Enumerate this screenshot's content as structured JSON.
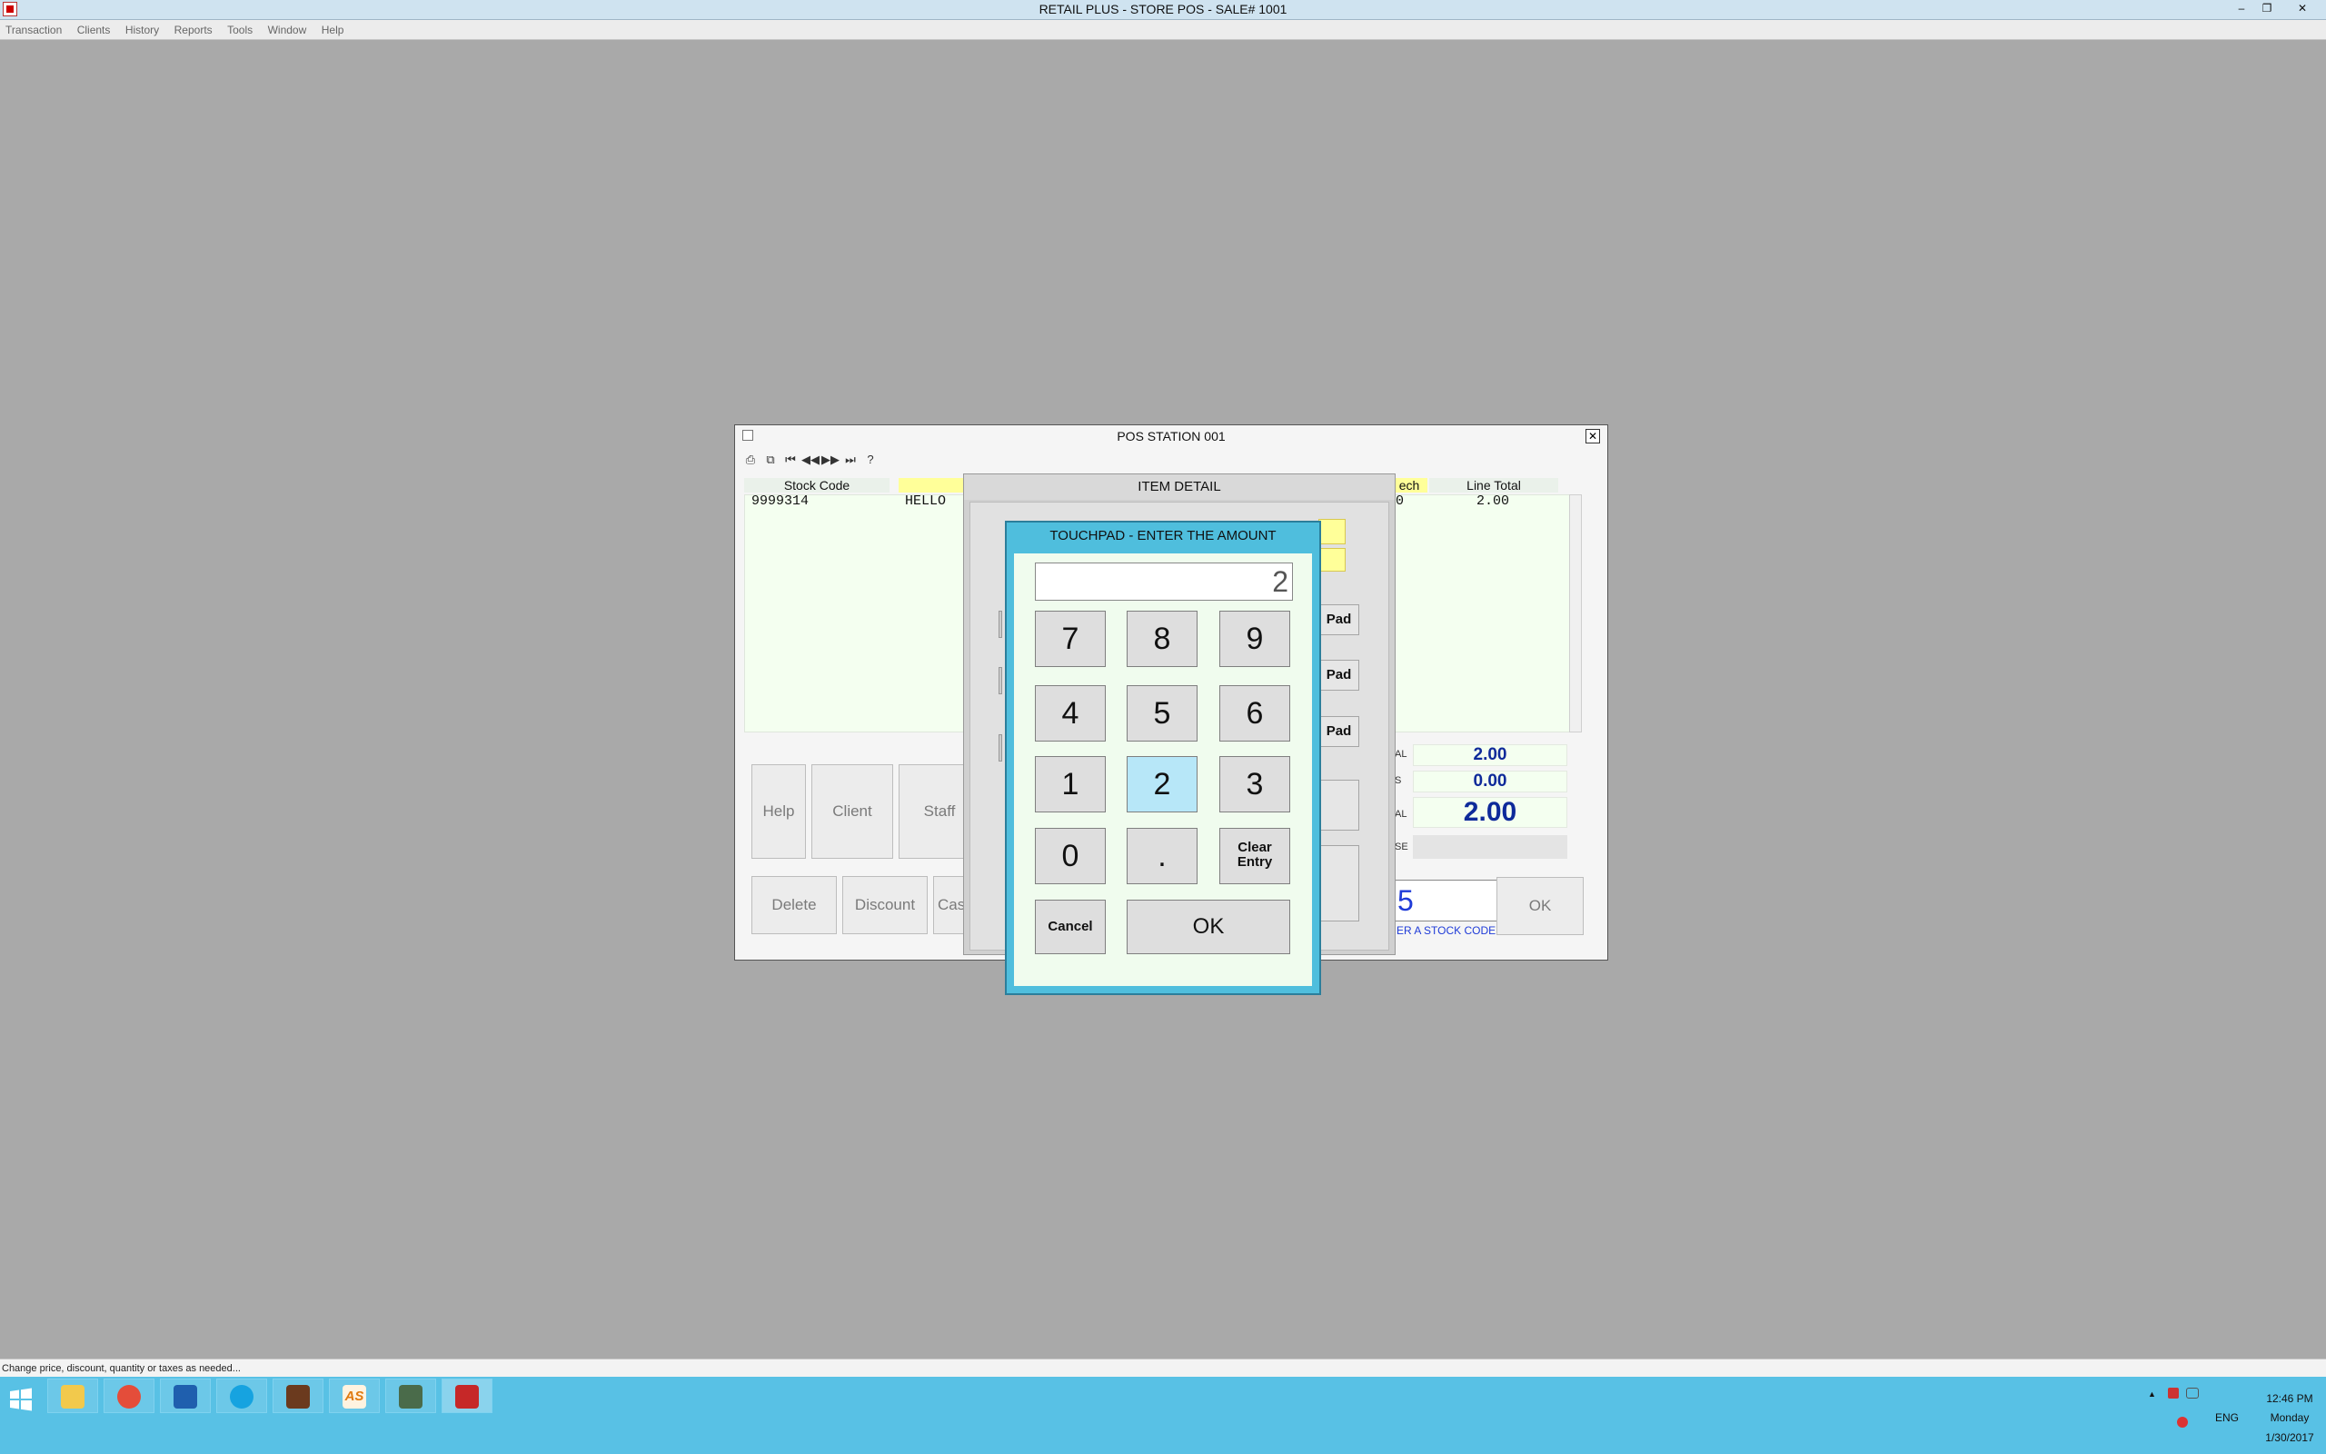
{
  "app": {
    "title": "RETAIL PLUS  -  STORE POS  -  SALE# 1001",
    "window_controls": [
      "–",
      "❐",
      "✕"
    ]
  },
  "menu": [
    "Transaction",
    "Clients",
    "History",
    "Reports",
    "Tools",
    "Window",
    "Help"
  ],
  "pos_window": {
    "title": "POS STATION 001",
    "close": "✕",
    "toolbar": [
      "⎙",
      "⧉",
      "⏮",
      "◀◀",
      "▶▶",
      "⏭",
      "?"
    ],
    "columns": {
      "stock_code": "Stock Code",
      "each": "ech",
      "line_total": "Line Total"
    },
    "row": {
      "stock_code": "9999314",
      "description": "HELLO ",
      "each": "0",
      "line_total": "2.00"
    },
    "buttons": {
      "help": "Help",
      "client": "Client",
      "staff": "Staff",
      "delete": "Delete",
      "discount": "Discount",
      "cash": "Cas",
      "ok": "OK"
    },
    "totals": {
      "subtotal_label": "AL",
      "subtotal": "2.00",
      "tax_label": "S",
      "tax": "0.00",
      "total_label": "AL",
      "total": "2.00",
      "extra_label": "SE"
    },
    "stock_entry": {
      "value": "5",
      "hint": "ER A STOCK CODE"
    }
  },
  "item_detail": {
    "title": "ITEM DETAIL",
    "pad_labels": [
      "Pad",
      "Pad",
      "Pad"
    ]
  },
  "touchpad": {
    "title": "TOUCHPAD - ENTER THE AMOUNT",
    "display": "2",
    "keys": {
      "k7": "7",
      "k8": "8",
      "k9": "9",
      "k4": "4",
      "k5": "5",
      "k6": "6",
      "k1": "1",
      "k2": "2",
      "k3": "3",
      "k0": "0",
      "kdot": ".",
      "clear_line1": "Clear",
      "clear_line2": "Entry",
      "cancel": "Cancel",
      "ok": "OK"
    },
    "selected_key": "2"
  },
  "status_bar": "Change price, discount, quantity or taxes as needed...",
  "taskbar": {
    "apps": [
      "file-explorer",
      "chrome",
      "outlook",
      "skype",
      "app-5",
      "app-as",
      "app-7",
      "app-8"
    ],
    "as_label": "AS",
    "tray": {
      "lang": "ENG",
      "time": "12:46 PM",
      "day": "Monday",
      "date": "1/30/2017",
      "arrow": "▲"
    }
  }
}
